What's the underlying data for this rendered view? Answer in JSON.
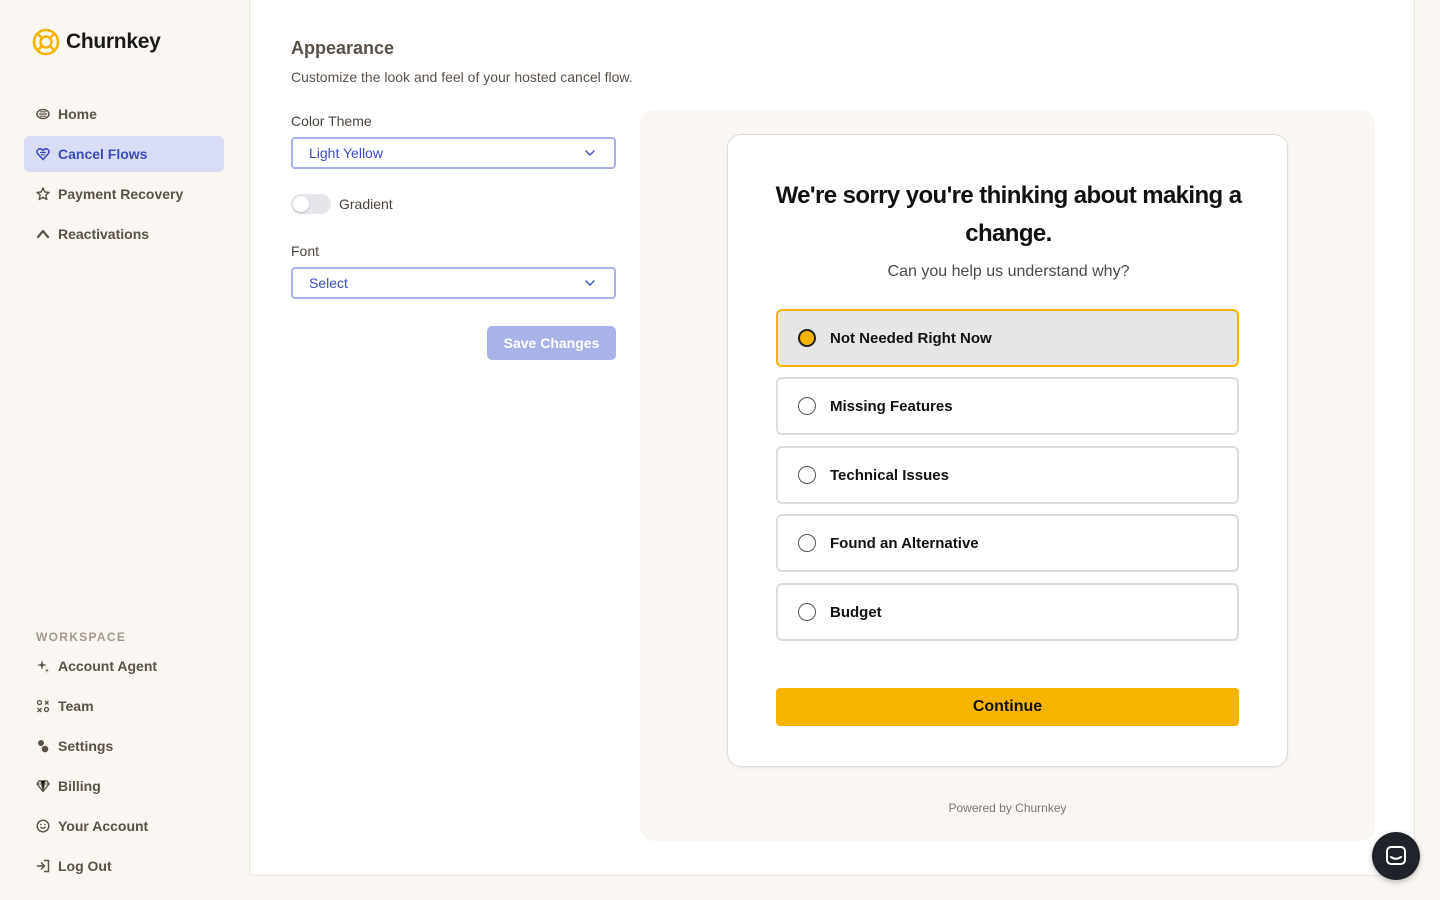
{
  "app": {
    "name": "Churnkey"
  },
  "sidebar": {
    "items": [
      {
        "label": "Home",
        "icon": "home-icon",
        "active": false
      },
      {
        "label": "Cancel Flows",
        "icon": "heart-icon",
        "active": true
      },
      {
        "label": "Payment Recovery",
        "icon": "star-badge-icon",
        "active": false
      },
      {
        "label": "Reactivations",
        "icon": "arrow-up-icon",
        "active": false
      }
    ],
    "workspace_label": "WORKSPACE",
    "workspace_items": [
      {
        "label": "Account Agent",
        "icon": "sparkle-icon"
      },
      {
        "label": "Team",
        "icon": "team-icon"
      },
      {
        "label": "Settings",
        "icon": "settings-icon"
      },
      {
        "label": "Billing",
        "icon": "diamond-icon"
      },
      {
        "label": "Your Account",
        "icon": "smile-icon"
      },
      {
        "label": "Log Out",
        "icon": "logout-icon"
      }
    ]
  },
  "appearance": {
    "title": "Appearance",
    "subtitle": "Customize the look and feel of your hosted cancel flow.",
    "color_theme_label": "Color Theme",
    "color_theme_value": "Light Yellow",
    "gradient_label": "Gradient",
    "gradient_on": false,
    "font_label": "Font",
    "font_value": "Select",
    "save_label": "Save Changes"
  },
  "preview": {
    "heading": "We're sorry you're thinking about making a change.",
    "subheading": "Can you help us understand why?",
    "options": [
      {
        "label": "Not Needed Right Now",
        "selected": true
      },
      {
        "label": "Missing Features",
        "selected": false
      },
      {
        "label": "Technical Issues",
        "selected": false
      },
      {
        "label": "Found an Alternative",
        "selected": false
      },
      {
        "label": "Budget",
        "selected": false
      }
    ],
    "continue_label": "Continue",
    "powered_by": "Powered by Churnkey",
    "accent_color": "#f5b400"
  },
  "colors": {
    "brand_blue": "#3b4cc0",
    "active_nav_bg": "#d9dcf5",
    "page_bg": "#faf6f1"
  }
}
